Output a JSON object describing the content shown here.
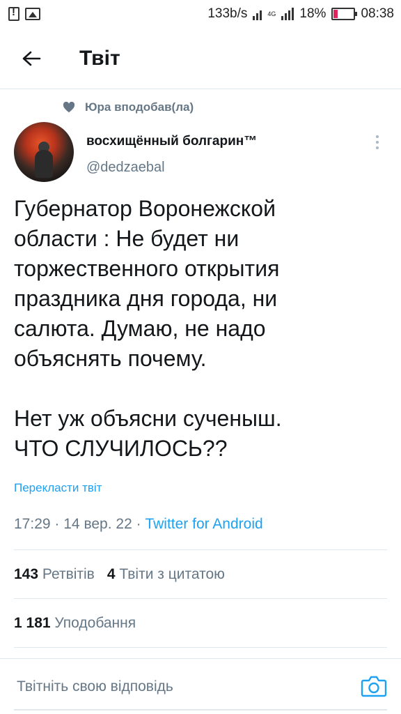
{
  "status_bar": {
    "network_speed": "133b/s",
    "network_type": "4G",
    "battery_percent": "18%",
    "battery_level": 0.18,
    "time": "08:38",
    "icons": [
      "alert-icon",
      "image-icon",
      "signal-icon",
      "signal-icon",
      "battery-icon"
    ]
  },
  "header": {
    "back_icon": "arrow-left-icon",
    "title": "Твіт"
  },
  "tweet": {
    "social_context": "Юра вподобав(ла)",
    "social_icon": "heart-icon",
    "author_name": "восхищённый болгарин™",
    "author_handle": "@dedzaebal",
    "more_icon": "more-vertical-icon",
    "text": "Губернатор Воронежской\nобласти : Не будет ни\nторжественного открытия\nпраздника дня города, ни\nсалюта. Думаю, не надо\nобъяснять почему.\n\nНет уж объясни сученыш.\nЧТО СЛУЧИЛОСЬ??",
    "translate_label": "Перекласти твіт",
    "time": "17:29",
    "date": "14 вер. 22",
    "separator": "·",
    "source": "Twitter for Android"
  },
  "stats": {
    "retweets_count": "143",
    "retweets_label": "Ретвітів",
    "quotes_count": "4",
    "quotes_label": "Твіти з цитатою",
    "likes_count": "1 181",
    "likes_label": "Уподобання"
  },
  "reply": {
    "placeholder": "Твітніть свою відповідь",
    "camera_icon": "camera-icon"
  },
  "colors": {
    "accent": "#1da1f2",
    "secondary_text": "#657786",
    "primary_text": "#14171a",
    "divider": "#e1e8ed"
  }
}
